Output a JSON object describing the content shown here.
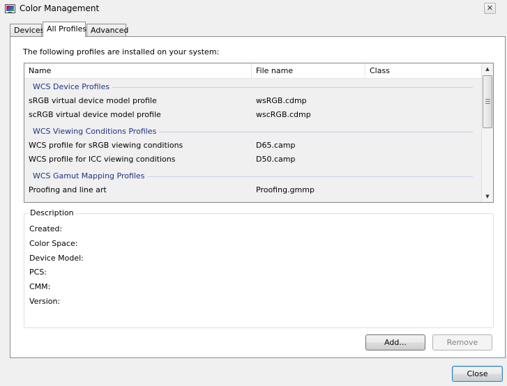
{
  "window": {
    "title": "Color Management",
    "close_glyph": "✕"
  },
  "tabs": [
    {
      "label": "Devices"
    },
    {
      "label": "All Profiles"
    },
    {
      "label": "Advanced"
    }
  ],
  "intro": "The following profiles are installed on your system:",
  "list": {
    "columns": [
      "Name",
      "File name",
      "Class"
    ],
    "groups": [
      {
        "title": "WCS Device Profiles",
        "rows": [
          {
            "name": "sRGB virtual device model profile",
            "file": "wsRGB.cdmp",
            "class": ""
          },
          {
            "name": "scRGB virtual device model profile",
            "file": "wscRGB.cdmp",
            "class": ""
          }
        ]
      },
      {
        "title": "WCS Viewing Conditions Profiles",
        "rows": [
          {
            "name": "WCS profile for sRGB viewing conditions",
            "file": "D65.camp",
            "class": ""
          },
          {
            "name": "WCS profile for ICC viewing conditions",
            "file": "D50.camp",
            "class": ""
          }
        ]
      },
      {
        "title": "WCS Gamut Mapping Profiles",
        "rows": [
          {
            "name": "Proofing and line art",
            "file": "Proofing.gmmp",
            "class": ""
          }
        ]
      }
    ],
    "scroll_up_icon": "▲",
    "scroll_down_icon": "▼"
  },
  "description": {
    "legend": "Description",
    "fields": [
      "Created:",
      "Color Space:",
      "Device Model:",
      "PCS:",
      "CMM:",
      "Version:"
    ]
  },
  "buttons": {
    "add": "Add...",
    "remove": "Remove",
    "close": "Close"
  }
}
